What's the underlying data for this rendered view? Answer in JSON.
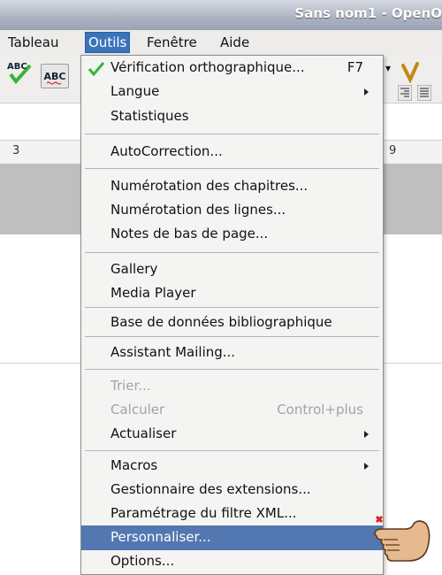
{
  "window": {
    "title": "Sans nom1 - OpenO"
  },
  "menubar": {
    "items": [
      "Tableau",
      "Outils",
      "Fenêtre",
      "Aide"
    ]
  },
  "toolbar": {
    "spell_label": "ABC",
    "autospell_label": "ABC"
  },
  "ruler": {
    "left_number": "3",
    "right_number": "9"
  },
  "menu": {
    "items": [
      {
        "label": "Vérification orthographique...",
        "shortcut": "F7"
      },
      {
        "label": "Langue"
      },
      {
        "label": "Statistiques"
      },
      {
        "label": "AutoCorrection..."
      },
      {
        "label": "Numérotation des chapitres..."
      },
      {
        "label": "Numérotation des lignes..."
      },
      {
        "label": "Notes de bas de page..."
      },
      {
        "label": "Gallery"
      },
      {
        "label": "Media Player"
      },
      {
        "label": "Base de données bibliographique"
      },
      {
        "label": "Assistant Mailing..."
      },
      {
        "label": "Trier..."
      },
      {
        "label": "Calculer",
        "shortcut": "Control+plus"
      },
      {
        "label": "Actualiser"
      },
      {
        "label": "Macros"
      },
      {
        "label": "Gestionnaire des extensions..."
      },
      {
        "label": "Paramétrage du filtre XML..."
      },
      {
        "label": "Personnaliser..."
      },
      {
        "label": "Options..."
      }
    ]
  },
  "colors": {
    "highlight": "#5377b0",
    "menubar_active": "#3b74bb",
    "disabled_text": "#a3a3a3"
  }
}
